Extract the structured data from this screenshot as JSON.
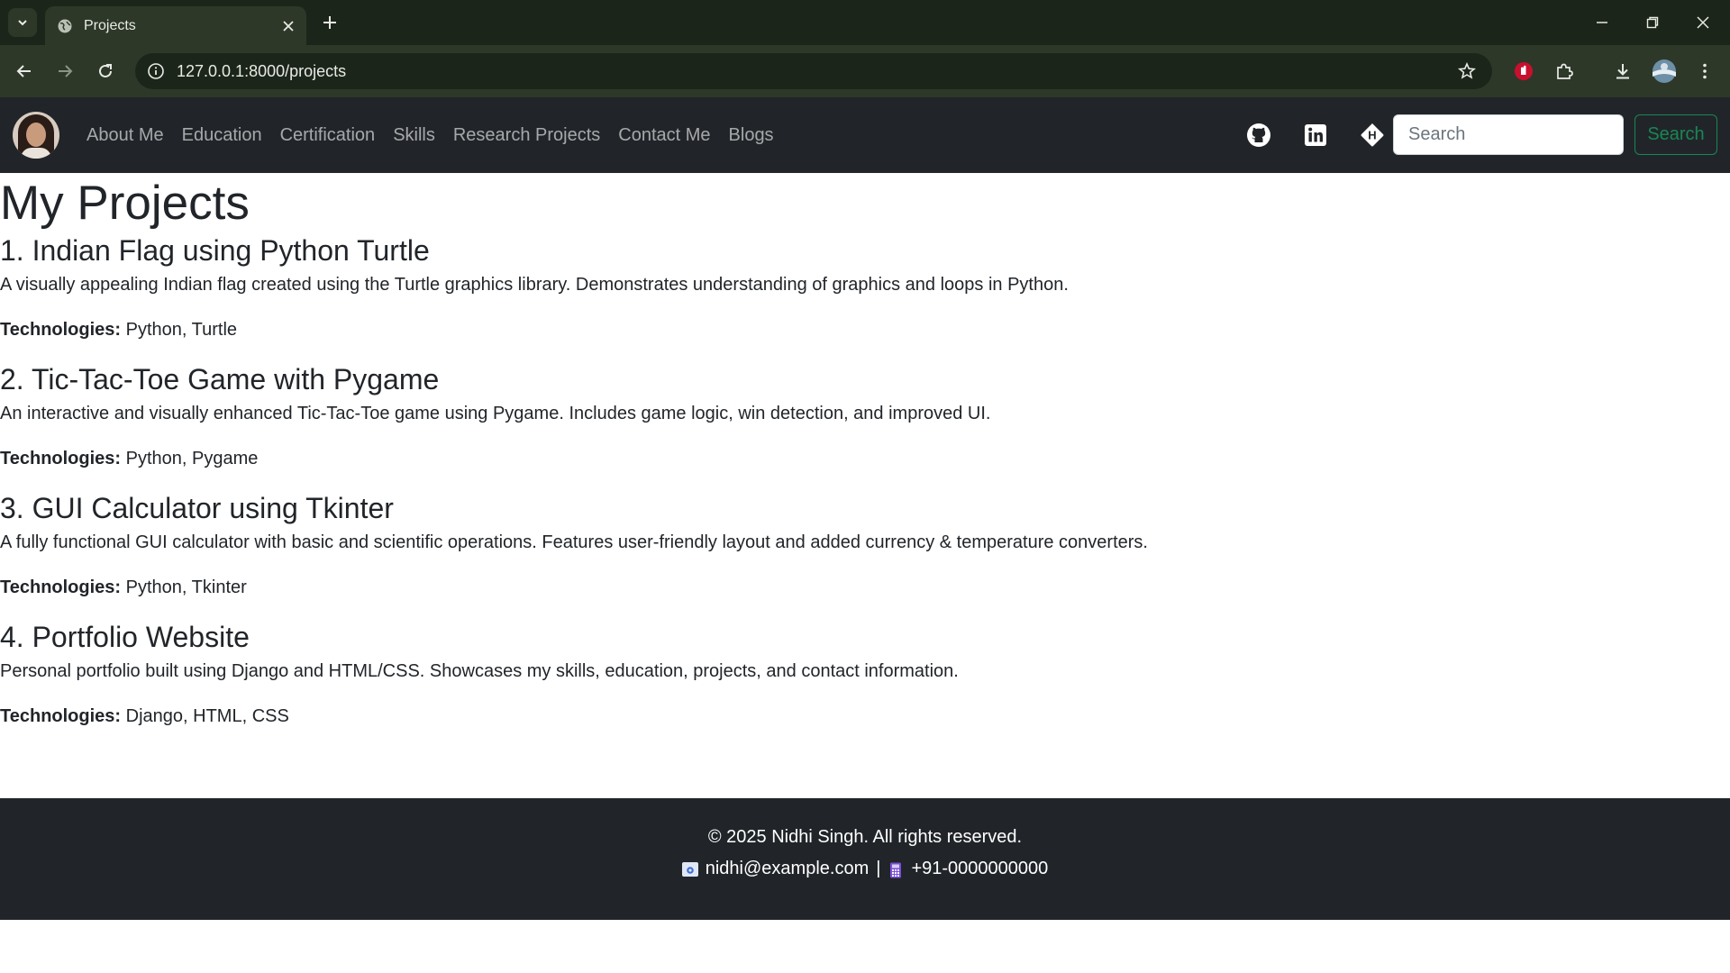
{
  "browser": {
    "tab_title": "Projects",
    "url": "127.0.0.1:8000/projects"
  },
  "navbar": {
    "links": [
      "About Me",
      "Education",
      "Certification",
      "Skills",
      "Research Projects",
      "Contact Me",
      "Blogs"
    ],
    "search_placeholder": "Search",
    "search_button": "Search"
  },
  "page": {
    "title": "My Projects",
    "projects": [
      {
        "heading": "1. Indian Flag using Python Turtle",
        "description": "A visually appealing Indian flag created using the Turtle graphics library. Demonstrates understanding of graphics and loops in Python.",
        "tech_label": "Technologies:",
        "tech": "Python, Turtle"
      },
      {
        "heading": "2. Tic-Tac-Toe Game with Pygame",
        "description": "An interactive and visually enhanced Tic-Tac-Toe game using Pygame. Includes game logic, win detection, and improved UI.",
        "tech_label": "Technologies:",
        "tech": "Python, Pygame"
      },
      {
        "heading": "3. GUI Calculator using Tkinter",
        "description": "A fully functional GUI calculator with basic and scientific operations. Features user-friendly layout and added currency & temperature converters.",
        "tech_label": "Technologies:",
        "tech": "Python, Tkinter"
      },
      {
        "heading": "4. Portfolio Website",
        "description": "Personal portfolio built using Django and HTML/CSS. Showcases my skills, education, projects, and contact information.",
        "tech_label": "Technologies:",
        "tech": "Django, HTML, CSS"
      }
    ]
  },
  "footer": {
    "copyright": "© 2025 Nidhi Singh. All rights reserved.",
    "email": "nidhi@example.com",
    "separator": "|",
    "phone": "+91-0000000000"
  },
  "colors": {
    "browser_frame": "#1c2519",
    "browser_toolbar": "#2d3829",
    "navbar_bg": "#212529",
    "search_button_accent": "#198754",
    "footer_bg": "#212529"
  }
}
